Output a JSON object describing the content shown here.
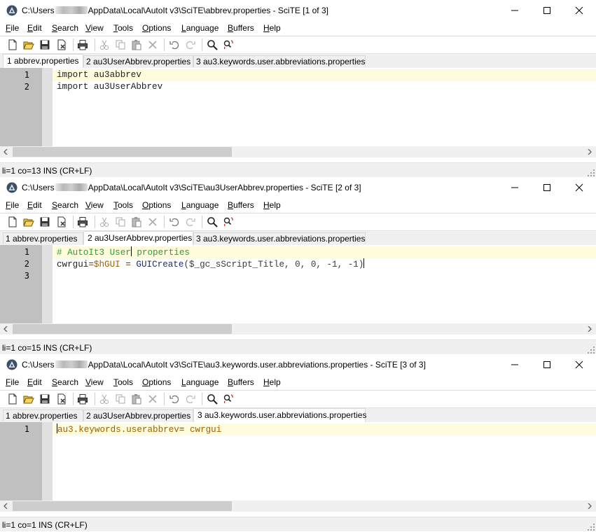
{
  "windows": [
    {
      "title_prefix": "C:\\Users",
      "title_suffix": "AppData\\Local\\AutoIt v3\\SciTE\\abbrev.properties - SciTE [1 of 3]",
      "active_tab": 0,
      "lines": [
        {
          "num": "1",
          "tokens": [
            {
              "t": "import au3abbrev",
              "c": "c-default"
            }
          ]
        },
        {
          "num": "2",
          "tokens": [
            {
              "t": "import au3UserAbbrev",
              "c": "c-default"
            }
          ]
        }
      ],
      "current_line": 0,
      "caret": null,
      "status": "li=1 co=13 INS (CR+LF)"
    },
    {
      "title_prefix": "C:\\Users",
      "title_suffix": "AppData\\Local\\AutoIt v3\\SciTE\\au3UserAbbrev.properties - SciTE [2 of 3]",
      "active_tab": 1,
      "lines": [
        {
          "num": "1",
          "tokens": [
            {
              "t": "# AutoIt3 User",
              "c": "c-comment"
            },
            {
              "t": "|",
              "c": "caret"
            },
            {
              "t": " properties",
              "c": "c-comment"
            }
          ]
        },
        {
          "num": "2",
          "tokens": [
            {
              "t": "cwrgui",
              "c": "c-default"
            },
            {
              "t": "=",
              "c": "c-op"
            },
            {
              "t": "$hGUI",
              "c": "c-var"
            },
            {
              "t": " = ",
              "c": "c-op"
            },
            {
              "t": "GUICreate",
              "c": "c-func"
            },
            {
              "t": "($_gc_sScript_Title, 0, 0, -1, -1)",
              "c": "c-num"
            },
            {
              "t": "|",
              "c": "caret"
            }
          ]
        },
        {
          "num": "3",
          "tokens": []
        }
      ],
      "current_line": 0,
      "status": "li=1 co=15 INS (CR+LF)"
    },
    {
      "title_prefix": "C:\\Users",
      "title_suffix": "AppData\\Local\\AutoIt v3\\SciTE\\au3.keywords.user.abbreviations.properties - SciTE [3 of 3]",
      "active_tab": 2,
      "lines": [
        {
          "num": "1",
          "tokens": [
            {
              "t": "|",
              "c": "caret"
            },
            {
              "t": "au3.keywords.userabbrev",
              "c": "c-var"
            },
            {
              "t": "= ",
              "c": "c-op"
            },
            {
              "t": "cwrgui",
              "c": "c-var"
            }
          ]
        }
      ],
      "current_line": 0,
      "status": "li=1 co=1 INS (CR+LF)"
    }
  ],
  "menu": [
    {
      "u": "F",
      "rest": "ile"
    },
    {
      "u": "E",
      "rest": "dit"
    },
    {
      "u": "S",
      "rest": "earch"
    },
    {
      "u": "V",
      "rest": "iew"
    },
    {
      "u": "T",
      "rest": "ools"
    },
    {
      "u": "O",
      "rest": "ptions"
    },
    {
      "u": "L",
      "rest": "anguage"
    },
    {
      "u": "B",
      "rest": "uffers"
    },
    {
      "u": "H",
      "rest": "elp"
    }
  ],
  "tabs": [
    "1 abbrev.properties",
    "2 au3UserAbbrev.properties",
    "3 au3.keywords.user.abbreviations.properties"
  ],
  "toolbar_icons": [
    "new-file-icon",
    "open-folder-icon",
    "save-icon",
    "close-file-icon",
    "print-icon",
    "cut-icon",
    "copy-icon",
    "paste-icon",
    "delete-icon",
    "undo-icon",
    "redo-icon",
    "find-icon",
    "replace-icon"
  ],
  "colors": {
    "current_line": "#fffcde",
    "gutter": "#c0c0c0",
    "comment": "#2e9e2e"
  }
}
